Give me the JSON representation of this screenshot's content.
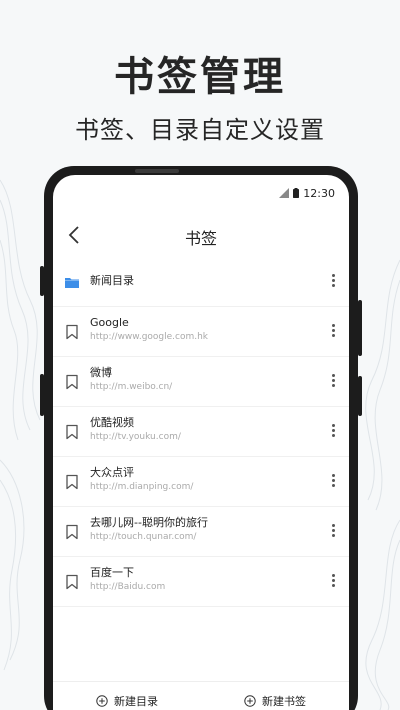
{
  "promo": {
    "headline": "书签管理",
    "subline": "书签、目录自定义设置"
  },
  "status_bar": {
    "time": "12:30",
    "icons": [
      "signal-icon",
      "battery-icon"
    ]
  },
  "nav": {
    "title": "书签",
    "back_icon": "back-arrow-icon"
  },
  "items": [
    {
      "type": "folder",
      "icon": "folder-icon",
      "title": "新闻目录",
      "url": ""
    },
    {
      "type": "bookmark",
      "icon": "bookmark-icon",
      "title": "Google",
      "url": "http://www.google.com.hk"
    },
    {
      "type": "bookmark",
      "icon": "bookmark-icon",
      "title": "微博",
      "url": "http://m.weibo.cn/"
    },
    {
      "type": "bookmark",
      "icon": "bookmark-icon",
      "title": "优酷视频",
      "url": "http://tv.youku.com/"
    },
    {
      "type": "bookmark",
      "icon": "bookmark-icon",
      "title": "大众点评",
      "url": "http://m.dianping.com/"
    },
    {
      "type": "bookmark",
      "icon": "bookmark-icon",
      "title": "去哪儿网--聪明你的旅行",
      "url": "http://touch.qunar.com/"
    },
    {
      "type": "bookmark",
      "icon": "bookmark-icon",
      "title": "百度一下",
      "url": "http://Baidu.com"
    }
  ],
  "bottom_bar": {
    "new_folder": "新建目录",
    "new_bookmark": "新建书签"
  },
  "colors": {
    "folder": "#3d8ee8",
    "background": "#f6f8f9",
    "phone_frame": "#1c1c1c"
  }
}
